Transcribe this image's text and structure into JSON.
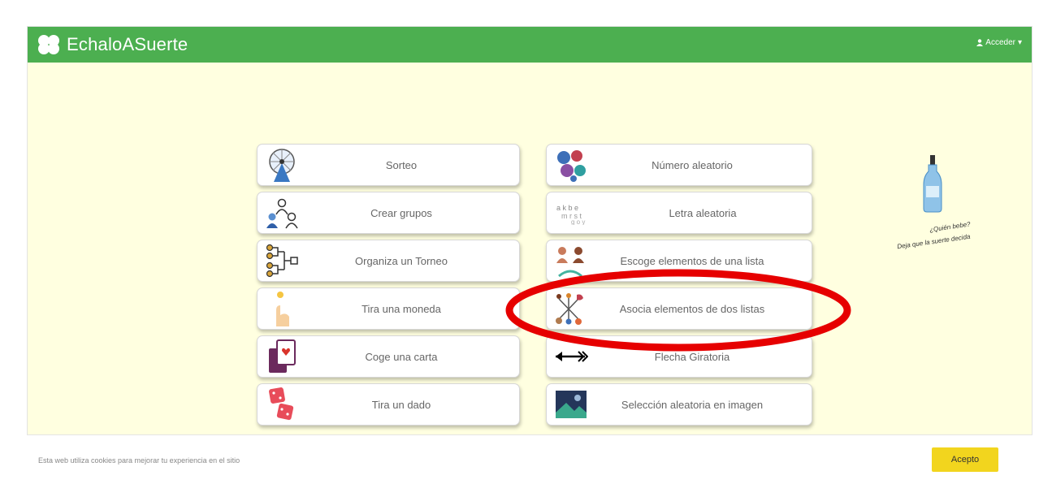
{
  "header": {
    "brand": "EchaloASuerte",
    "login_label": "Acceder",
    "color": "#4caf50"
  },
  "page": {
    "background": "#ffffe0"
  },
  "tools_left": [
    {
      "label": "Sorteo",
      "icon": "raffle-wheel-icon"
    },
    {
      "label": "Crear grupos",
      "icon": "people-groups-icon"
    },
    {
      "label": "Organiza un Torneo",
      "icon": "tournament-bracket-icon"
    },
    {
      "label": "Tira una moneda",
      "icon": "coin-flip-icon"
    },
    {
      "label": "Coge una carta",
      "icon": "playing-card-icon"
    },
    {
      "label": "Tira un dado",
      "icon": "dice-icon"
    }
  ],
  "tools_right": [
    {
      "label": "Número aleatorio",
      "icon": "numbers-icon"
    },
    {
      "label": "Letra aleatoria",
      "icon": "letters-icon"
    },
    {
      "label": "Escoge elementos de una lista",
      "icon": "choose-items-icon"
    },
    {
      "label": "Asocia elementos de dos listas",
      "icon": "associate-lists-icon"
    },
    {
      "label": "Flecha Giratoria",
      "icon": "spinning-arrow-icon"
    },
    {
      "label": "Selección aleatoria en imagen",
      "icon": "image-icon"
    }
  ],
  "promo": {
    "line1": "¿Quién bebe?",
    "line2": "Deja que la suerte decida"
  },
  "cookie_banner": {
    "text": "Esta web utiliza cookies para mejorar tu experiencia en el sitio",
    "accept_label": "Acepto"
  },
  "annotation": {
    "color": "#e60000",
    "highlighted_item": "Asocia elementos de dos listas"
  }
}
